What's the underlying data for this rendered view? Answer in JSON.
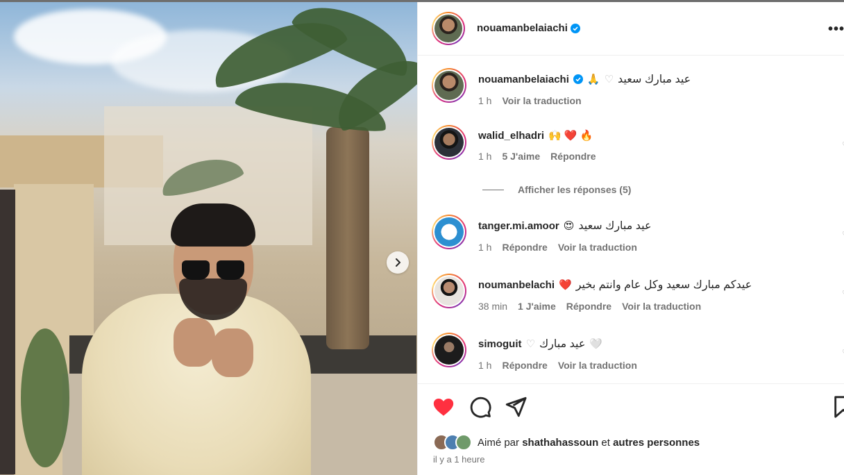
{
  "post": {
    "author": "nouamanbelaiachi",
    "verified": true,
    "more_label": "•••"
  },
  "caption": {
    "username": "nouamanbelaiachi",
    "text": "عيد مبارك سعيد",
    "time": "1 h",
    "translate": "Voir la traduction"
  },
  "comments": [
    {
      "username": "walid_elhadri",
      "text": "",
      "emojis": "🙌 ❤️ 🔥",
      "time": "1 h",
      "likes": "5 J'aime",
      "reply": "Répondre",
      "translate": ""
    },
    {
      "username": "tanger.mi.amoor",
      "text": "عيد مبارك سعيد",
      "emojis": "😍",
      "time": "1 h",
      "likes": "",
      "reply": "Répondre",
      "translate": "Voir la traduction"
    },
    {
      "username": "noumanbelachi",
      "text": "عيدكم مبارك سعيد وكل عام وانتم بخير",
      "emojis": "❤️",
      "time": "38 min",
      "likes": "1 J'aime",
      "reply": "Répondre",
      "translate": "Voir la traduction"
    },
    {
      "username": "simoguit",
      "text": "عيد مبارك",
      "emojis": "🤍",
      "time": "1 h",
      "likes": "",
      "reply": "Répondre",
      "translate": "Voir la traduction"
    }
  ],
  "view_replies": "Afficher les réponses (5)",
  "liked_by": {
    "prefix": "Aimé par",
    "user": "shathahassoun",
    "joiner": "et",
    "others": "autres personnes"
  },
  "posted_ago": "il y a 1 heure",
  "colors": {
    "heart": "#ff3040",
    "verified": "#0095f6",
    "muted": "#737373"
  },
  "icons": [
    "chevron-right-icon",
    "heart-icon",
    "comment-icon",
    "share-icon",
    "bookmark-icon",
    "verified-icon",
    "more-icon"
  ]
}
